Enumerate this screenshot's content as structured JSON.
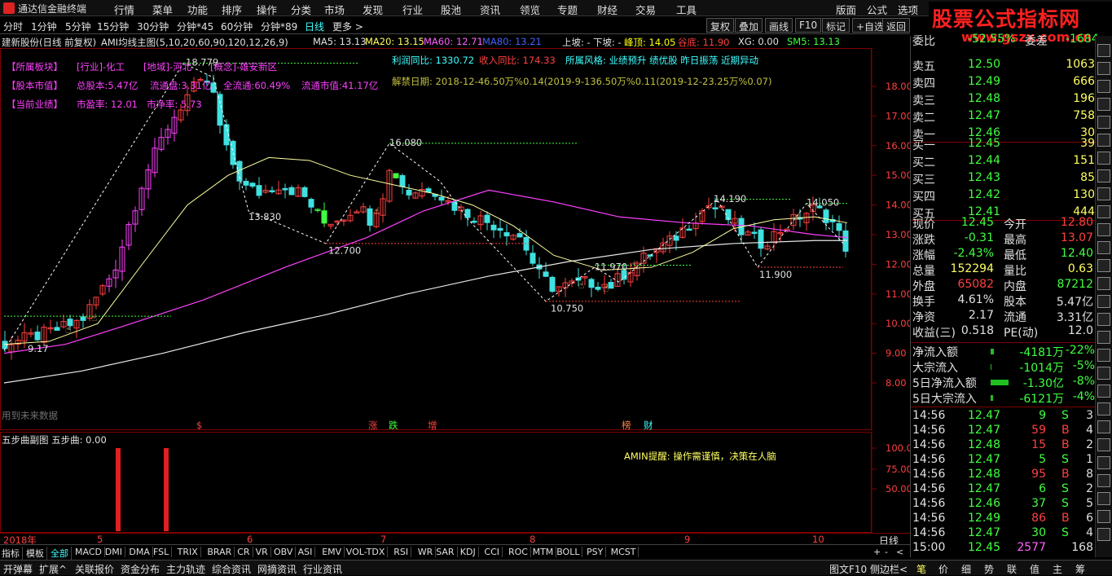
{
  "app": {
    "title": "通达信金融终端"
  },
  "menu": [
    "行情",
    "菜单",
    "功能",
    "排序",
    "操作",
    "分类",
    "市场",
    "发现",
    "行业",
    "股池",
    "资讯",
    "领览",
    "专题",
    "财经",
    "交易",
    "工具"
  ],
  "menu_right": [
    "版面",
    "公式",
    "选项"
  ],
  "brand": {
    "line1": "股票公式指标网",
    "line2": "www.gszx.com.cn"
  },
  "periods": [
    "分时",
    "1分钟",
    "5分钟",
    "15分钟",
    "30分钟",
    "分钟*45",
    "60分钟",
    "分钟*89",
    "日线",
    "更多 >"
  ],
  "active_period": "日线",
  "tool_buttons": [
    "复权",
    "叠加",
    "画线",
    "F10",
    "标记",
    "+自选",
    "返回"
  ],
  "stock": {
    "name": "建新股份(日线 前复权)",
    "main_indicator": "AMI均线主图(5,10,20,60,90,120,12,26,9)"
  },
  "ma": {
    "ma5": "MA5: 13.13",
    "ma20": "MA20: 13.15",
    "ma60": "MA60: 12.71",
    "ma80": "MA80: 13.21"
  },
  "signals": {
    "up": "上坡: -",
    "down": "下坡: -",
    "peak": "峰顶: 14.05",
    "valley": "谷底: 11.90",
    "xg": "XG: 0.00",
    "sm5": "SM5: 13.13"
  },
  "info": {
    "sector": "【所属板块】",
    "industry": "[行业]-化工",
    "region": "[地域]-河北",
    "concept": "[概念]-雄安新区",
    "profit_yoy": "利润同比: 1330.72",
    "rev_yoy": "收入同比: 174.33",
    "style": "所属风格: 业绩预升 绩优股 昨日振荡 近期异动",
    "equity": "【股本市值】",
    "total_shares": "总股本:5.47亿",
    "float_shares": "流通盘:3.31亿",
    "float_pct": "全流通:60.49%",
    "float_mv": "流通市值:41.17亿",
    "unlock": "解禁日期: 2018-12-46.50万%0.14(2019-9-136.50万%0.11(2019-12-23.25万%0.07)",
    "perf": "【当前业绩】",
    "pe": "市盈率: 12.01",
    "pb": "市净率: 5.73"
  },
  "price_labels": [
    "18.00",
    "17.00",
    "16.00",
    "15.00",
    "14.00",
    "13.00",
    "12.00",
    "11.00",
    "10.00",
    "9.00",
    "8.00"
  ],
  "annotations": {
    "high1": "18.779",
    "high2": "16.080",
    "low1": "13.830",
    "low2": "12.700",
    "low3": "10.750",
    "mid1": "11.970",
    "high3": "14.190",
    "high4": "14.050",
    "low4": "11.900",
    "start": "9.17"
  },
  "future_data": "用到未来数据",
  "events": [
    "$",
    "涨",
    "跌",
    "增",
    "榜",
    "财"
  ],
  "sub": {
    "title": "五步曲副图 五步曲: 0.00",
    "labels": [
      "100.0",
      "75.00",
      "50.00"
    ],
    "tip": "AMIN提醒: 操作需谨慎，决策在人脑"
  },
  "dates": {
    "year": "2018年",
    "months": [
      "5",
      "6",
      "7",
      "8",
      "9",
      "10"
    ],
    "period": "日线"
  },
  "indicators": [
    "指标",
    "模板",
    "全部",
    "MACD",
    "DMI",
    "DMA",
    "FSL",
    "TRIX",
    "BRAR",
    "CR",
    "VR",
    "OBV",
    "ASI",
    "EMV",
    "VOL-TDX",
    "RSI",
    "WR",
    "SAR",
    "KDJ",
    "CCI",
    "ROC",
    "MTM",
    "BOLL",
    "PSY",
    "MCST"
  ],
  "bottom_tabs": [
    "开弹幕",
    "扩展^",
    "关联报价",
    "资金分布",
    "主力轨迹",
    "综合资讯",
    "网摘资讯",
    "行业资讯"
  ],
  "bottom_right": [
    "图文F10",
    "侧边栏<"
  ],
  "right_tabs": [
    "笔",
    "价",
    "细",
    "势",
    "联",
    "值",
    "主",
    "筹"
  ],
  "committee": {
    "label": "委比",
    "value": "-52.55%",
    "label2": "委差",
    "value2": "-1684"
  },
  "asks": [
    {
      "label": "卖五",
      "price": "12.50",
      "vol": "1063"
    },
    {
      "label": "卖四",
      "price": "12.49",
      "vol": "666"
    },
    {
      "label": "卖三",
      "price": "12.48",
      "vol": "196"
    },
    {
      "label": "卖二",
      "price": "12.47",
      "vol": "758"
    },
    {
      "label": "卖一",
      "price": "12.46",
      "vol": "30"
    }
  ],
  "bids": [
    {
      "label": "买一",
      "price": "12.45",
      "vol": "39"
    },
    {
      "label": "买二",
      "price": "12.44",
      "vol": "151"
    },
    {
      "label": "买三",
      "price": "12.43",
      "vol": "85"
    },
    {
      "label": "买四",
      "price": "12.42",
      "vol": "130"
    },
    {
      "label": "买五",
      "price": "12.41",
      "vol": "444"
    }
  ],
  "quote": [
    {
      "l1": "现价",
      "v1": "12.45",
      "l2": "今开",
      "v2": "12.80"
    },
    {
      "l1": "涨跌",
      "v1": "-0.31",
      "l2": "最高",
      "v2": "13.07"
    },
    {
      "l1": "涨幅",
      "v1": "-2.43%",
      "l2": "最低",
      "v2": "12.40"
    },
    {
      "l1": "总量",
      "v1": "152294",
      "l2": "量比",
      "v2": "0.63"
    },
    {
      "l1": "外盘",
      "v1": "65082",
      "l2": "内盘",
      "v2": "87212"
    },
    {
      "l1": "换手",
      "v1": "4.61%",
      "l2": "股本",
      "v2": "5.47亿"
    },
    {
      "l1": "净资",
      "v1": "2.17",
      "l2": "流通",
      "v2": "3.31亿"
    },
    {
      "l1": "收益(三)",
      "v1": "0.518",
      "l2": "PE(动)",
      "v2": "12.0"
    }
  ],
  "flows": [
    {
      "label": "净流入额",
      "value": "-4181万",
      "pct": "-22%"
    },
    {
      "label": "大宗流入",
      "value": "-1014万",
      "pct": "-5%"
    },
    {
      "label": "5日净流入额",
      "value": "-1.30亿",
      "pct": "-8%"
    },
    {
      "label": "5日大宗流入",
      "value": "-6121万",
      "pct": "-4%"
    }
  ],
  "ticks": [
    {
      "time": "14:56",
      "price": "12.47",
      "vol": "9",
      "side": "S",
      "n": "3"
    },
    {
      "time": "14:56",
      "price": "12.47",
      "vol": "59",
      "side": "B",
      "n": "4"
    },
    {
      "time": "14:56",
      "price": "12.48",
      "vol": "15",
      "side": "B",
      "n": "2"
    },
    {
      "time": "14:56",
      "price": "12.47",
      "vol": "5",
      "side": "S",
      "n": "1"
    },
    {
      "time": "14:56",
      "price": "12.48",
      "vol": "95",
      "side": "B",
      "n": "8"
    },
    {
      "time": "14:56",
      "price": "12.47",
      "vol": "6",
      "side": "S",
      "n": "2"
    },
    {
      "time": "14:56",
      "price": "12.46",
      "vol": "37",
      "side": "S",
      "n": "5"
    },
    {
      "time": "14:56",
      "price": "12.49",
      "vol": "86",
      "side": "B",
      "n": "6"
    },
    {
      "time": "14:56",
      "price": "12.47",
      "vol": "30",
      "side": "S",
      "n": "4"
    },
    {
      "time": "15:00",
      "price": "12.45",
      "vol": "2577",
      "side": "",
      "n": "168"
    }
  ]
}
